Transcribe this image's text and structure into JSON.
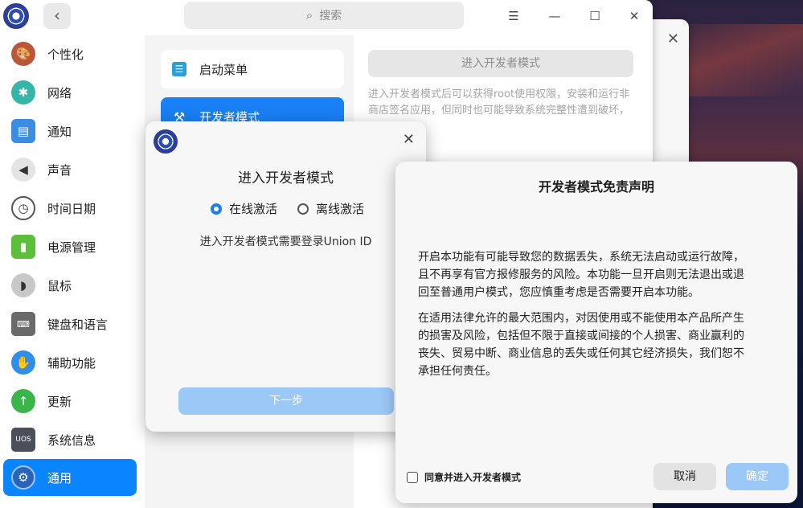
{
  "titlebar": {
    "search_placeholder": "搜索",
    "search_icon": "search-icon",
    "back_icon": "‹",
    "menu_icon": "☰",
    "minimize_icon": "—",
    "maximize_icon": "☐",
    "close_icon": "✕"
  },
  "sidebar": {
    "items": [
      {
        "label": "个性化",
        "icon": "personalization-icon"
      },
      {
        "label": "网络",
        "icon": "network-icon"
      },
      {
        "label": "通知",
        "icon": "notification-icon"
      },
      {
        "label": "声音",
        "icon": "sound-icon"
      },
      {
        "label": "时间日期",
        "icon": "clock-icon"
      },
      {
        "label": "电源管理",
        "icon": "battery-icon"
      },
      {
        "label": "鼠标",
        "icon": "mouse-icon"
      },
      {
        "label": "键盘和语言",
        "icon": "keyboard-icon"
      },
      {
        "label": "辅助功能",
        "icon": "accessibility-icon"
      },
      {
        "label": "更新",
        "icon": "update-icon"
      },
      {
        "label": "系统信息",
        "icon": "system-info-icon"
      },
      {
        "label": "通用",
        "icon": "general-icon"
      }
    ],
    "active_index": 11
  },
  "midlist": {
    "items": [
      {
        "label": "启动菜单",
        "icon": "boot-menu-icon"
      },
      {
        "label": "开发者模式",
        "icon": "developer-tools-icon"
      }
    ],
    "active_index": 1
  },
  "content": {
    "enter_dev_button": "进入开发者模式",
    "description": "进入开发者模式后可以获得root使用权限，安装和运行非商店签名应用，但同时也可能导致系统完整性遭到破坏，"
  },
  "dialog_enter": {
    "title": "进入开发者模式",
    "options": [
      {
        "label": "在线激活",
        "checked": true
      },
      {
        "label": "离线激活",
        "checked": false
      }
    ],
    "message": "进入开发者模式需要登录Union ID",
    "next_button": "下一步"
  },
  "dialog_disclaimer": {
    "title": "开发者模式免责声明",
    "paragraph1": "开启本功能有可能导致您的数据丢失，系统无法启动或运行故障，且不再享有官方报修服务的风险。本功能一旦开启则无法退出或退回至普通用户模式，您应慎重考虑是否需要开启本功能。",
    "paragraph2": "在适用法律允许的最大范围内，对因使用或不能使用本产品所产生的损害及风险，包括但不限于直接或间接的个人损害、商业赢利的丧失、贸易中断、商业信息的丢失或任何其它经济损失，我们恕不承担任何责任。",
    "agree_label": "同意并进入开发者模式",
    "agree_checked": false,
    "cancel_button": "取消",
    "ok_button": "确定"
  }
}
